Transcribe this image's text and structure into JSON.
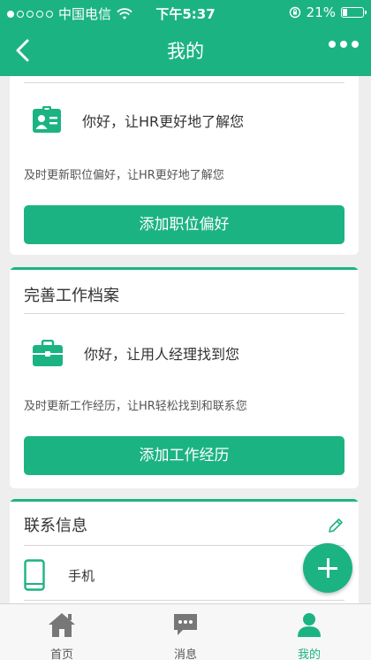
{
  "status_bar": {
    "carrier": "中国电信",
    "time": "下午5:37",
    "battery": "21%",
    "battery_level": 0.21
  },
  "nav": {
    "title": "我的"
  },
  "preference_card": {
    "hello": "你好，让HR更好地了解您",
    "desc": "及时更新职位偏好，让HR更好地了解您",
    "button": "添加职位偏好"
  },
  "work_card": {
    "title": "完善工作档案",
    "hello": "你好，让用人经理找到您",
    "desc": "及时更新工作经历，让HR轻松找到和联系您",
    "button": "添加工作经历"
  },
  "contact_card": {
    "title": "联系信息",
    "phone_label": "手机"
  },
  "tabs": [
    {
      "label": "首页",
      "icon": "home-icon",
      "active": false
    },
    {
      "label": "消息",
      "icon": "message-icon",
      "active": false
    },
    {
      "label": "我的",
      "icon": "person-icon",
      "active": true
    }
  ],
  "colors": {
    "brand": "#1cb383",
    "background": "#eeeeee"
  }
}
